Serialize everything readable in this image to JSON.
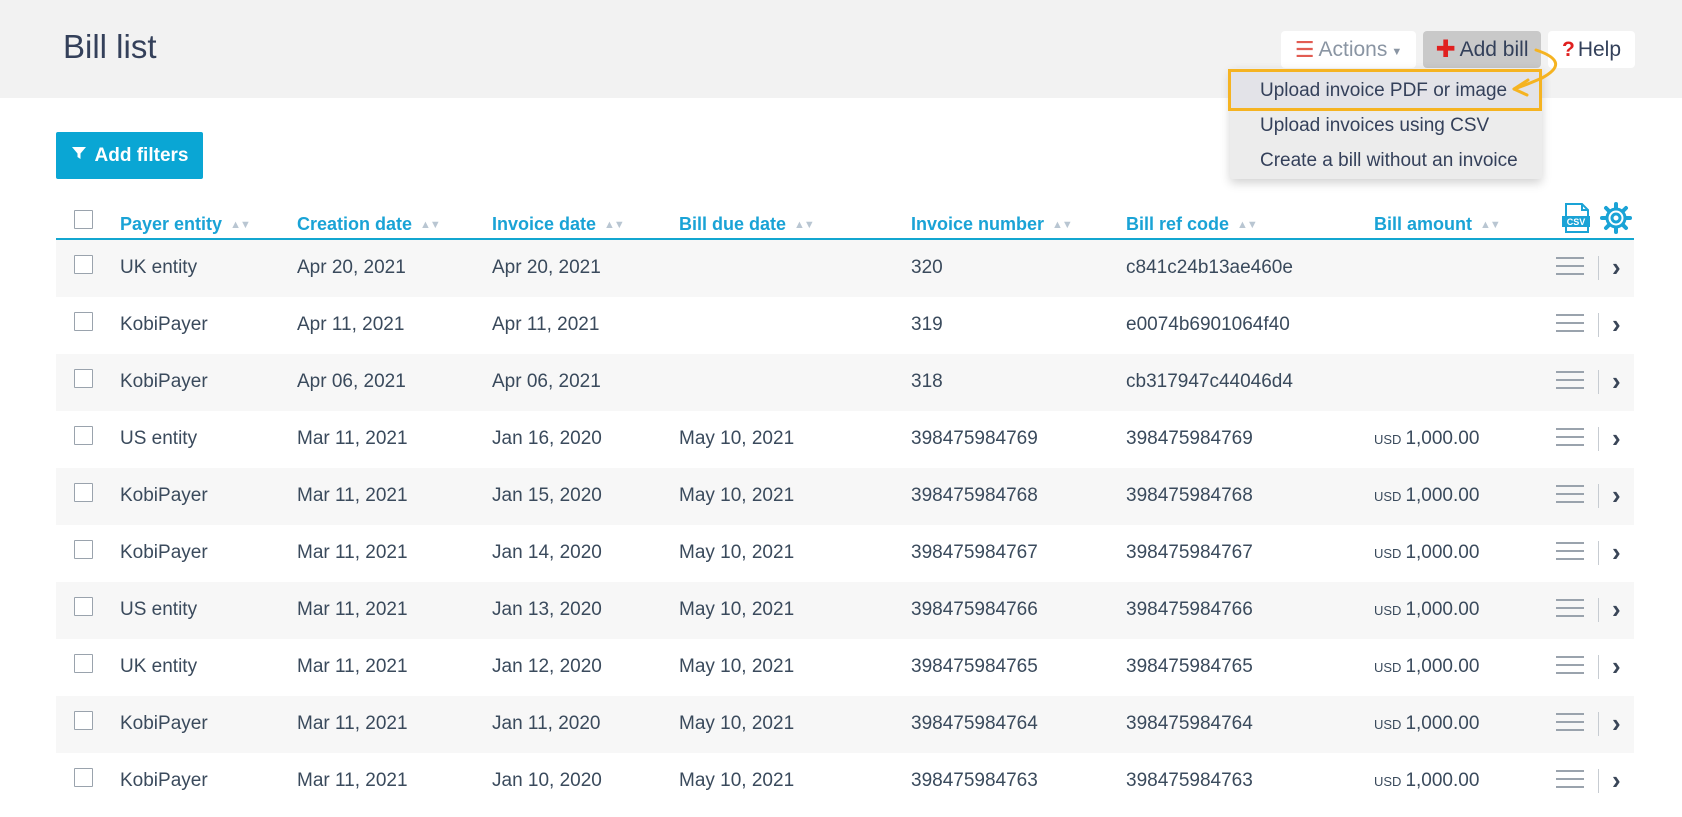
{
  "header": {
    "title": "Bill list",
    "actions_label": "Actions",
    "add_bill_label": "Add bill",
    "help_label": "Help"
  },
  "add_bill_menu": {
    "items": [
      "Upload invoice PDF or image",
      "Upload invoices using CSV",
      "Create a bill without an invoice"
    ],
    "highlighted_index": 0,
    "highlight_color": "#f5b321"
  },
  "filters": {
    "label": "Add filters"
  },
  "table": {
    "columns": [
      "Payer entity",
      "Creation date",
      "Invoice date",
      "Bill due date",
      "Invoice number",
      "Bill ref code",
      "Bill amount"
    ],
    "csv_icon_label": "CSV",
    "rows": [
      {
        "payer": "UK entity",
        "created": "Apr 20, 2021",
        "invoice_date": "Apr 20, 2021",
        "due": "",
        "invoice_no": "320",
        "ref": "c841c24b13ae460e",
        "currency": "",
        "amount": ""
      },
      {
        "payer": "KobiPayer",
        "created": "Apr 11, 2021",
        "invoice_date": "Apr 11, 2021",
        "due": "",
        "invoice_no": "319",
        "ref": "e0074b6901064f40",
        "currency": "",
        "amount": ""
      },
      {
        "payer": "KobiPayer",
        "created": "Apr 06, 2021",
        "invoice_date": "Apr 06, 2021",
        "due": "",
        "invoice_no": "318",
        "ref": "cb317947c44046d4",
        "currency": "",
        "amount": ""
      },
      {
        "payer": "US entity",
        "created": "Mar 11, 2021",
        "invoice_date": "Jan 16, 2020",
        "due": "May 10, 2021",
        "invoice_no": "398475984769",
        "ref": "398475984769",
        "currency": "USD",
        "amount": "1,000.00"
      },
      {
        "payer": "KobiPayer",
        "created": "Mar 11, 2021",
        "invoice_date": "Jan 15, 2020",
        "due": "May 10, 2021",
        "invoice_no": "398475984768",
        "ref": "398475984768",
        "currency": "USD",
        "amount": "1,000.00"
      },
      {
        "payer": "KobiPayer",
        "created": "Mar 11, 2021",
        "invoice_date": "Jan 14, 2020",
        "due": "May 10, 2021",
        "invoice_no": "398475984767",
        "ref": "398475984767",
        "currency": "USD",
        "amount": "1,000.00"
      },
      {
        "payer": "US entity",
        "created": "Mar 11, 2021",
        "invoice_date": "Jan 13, 2020",
        "due": "May 10, 2021",
        "invoice_no": "398475984766",
        "ref": "398475984766",
        "currency": "USD",
        "amount": "1,000.00"
      },
      {
        "payer": "UK entity",
        "created": "Mar 11, 2021",
        "invoice_date": "Jan 12, 2020",
        "due": "May 10, 2021",
        "invoice_no": "398475984765",
        "ref": "398475984765",
        "currency": "USD",
        "amount": "1,000.00"
      },
      {
        "payer": "KobiPayer",
        "created": "Mar 11, 2021",
        "invoice_date": "Jan 11, 2020",
        "due": "May 10, 2021",
        "invoice_no": "398475984764",
        "ref": "398475984764",
        "currency": "USD",
        "amount": "1,000.00"
      },
      {
        "payer": "KobiPayer",
        "created": "Mar 11, 2021",
        "invoice_date": "Jan 10, 2020",
        "due": "May 10, 2021",
        "invoice_no": "398475984763",
        "ref": "398475984763",
        "currency": "USD",
        "amount": "1,000.00"
      }
    ]
  },
  "colors": {
    "accent": "#1aa3d6",
    "filter_button": "#0aa6d4",
    "actions_icon": "#e25c52",
    "add_icon": "#e0201f"
  },
  "icons": {
    "actions": "hamburger-icon",
    "add": "plus-icon",
    "help": "question-icon",
    "filter": "funnel-icon",
    "csv": "csv-file-icon",
    "settings": "gear-icon",
    "row_menu": "hamburger-icon",
    "row_open": "chevron-right-icon"
  }
}
